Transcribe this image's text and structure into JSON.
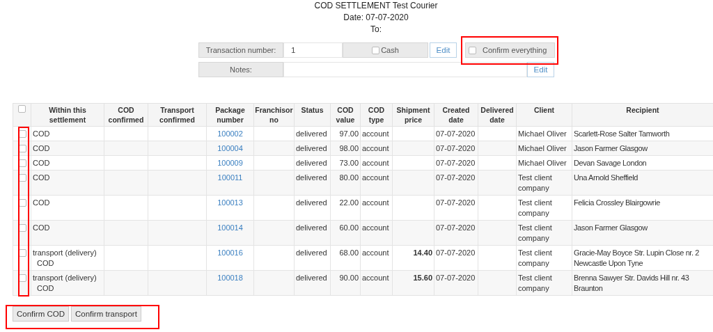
{
  "header": {
    "title": "COD SETTLEMENT Test Courier",
    "date": "Date: 07-07-2020",
    "to": "To:"
  },
  "form": {
    "transaction_label": "Transaction number:",
    "transaction_value": "1",
    "cash": {
      "label": "Cash",
      "checked": false
    },
    "edit_button": "Edit",
    "confirm_everything": {
      "label": "Confirm everything",
      "checked": false
    },
    "notes_label": "Notes:",
    "notes_edit_button": "Edit"
  },
  "table": {
    "select_all": {
      "checked": false
    },
    "columns": [
      "Within this settlement",
      "COD confirmed",
      "Transport confirmed",
      "Package number",
      "Franchisor no",
      "Status",
      "COD value",
      "COD type",
      "Shipment price",
      "Created date",
      "Delivered date",
      "Client",
      "Recipient"
    ],
    "rows": [
      {
        "checked": false,
        "within": [
          "COD"
        ],
        "cod_confirmed": "",
        "transport_confirmed": "",
        "package": "100002",
        "franchisor": "",
        "status": "delivered",
        "cod_value": "97.00",
        "cod_type": "account",
        "shipment_price": "",
        "created": "07-07-2020",
        "delivered": "",
        "client": "Michael Oliver",
        "recipient": "Scarlett-Rose Salter Tamworth"
      },
      {
        "checked": false,
        "within": [
          "COD"
        ],
        "package": "100004",
        "status": "delivered",
        "cod_value": "98.00",
        "cod_type": "account",
        "created": "07-07-2020",
        "client": "Michael Oliver",
        "recipient": "Jason Farmer Glasgow"
      },
      {
        "checked": false,
        "within": [
          "COD"
        ],
        "package": "100009",
        "status": "delivered",
        "cod_value": "73.00",
        "cod_type": "account",
        "created": "07-07-2020",
        "client": "Michael Oliver",
        "recipient": "Devan Savage London"
      },
      {
        "checked": false,
        "within": [
          "COD"
        ],
        "package": "100011",
        "status": "delivered",
        "cod_value": "80.00",
        "cod_type": "account",
        "created": "07-07-2020",
        "client": "Test client company",
        "recipient": "Una Arnold Sheffield"
      },
      {
        "checked": false,
        "within": [
          "COD"
        ],
        "package": "100013",
        "status": "delivered",
        "cod_value": "22.00",
        "cod_type": "account",
        "created": "07-07-2020",
        "client": "Test client company",
        "recipient": "Felicia Crossley Blairgowrie"
      },
      {
        "checked": false,
        "within": [
          "COD"
        ],
        "package": "100014",
        "status": "delivered",
        "cod_value": "60.00",
        "cod_type": "account",
        "created": "07-07-2020",
        "client": "Test client company",
        "recipient": "Jason Farmer Glasgow"
      },
      {
        "checked": false,
        "within": [
          "transport (delivery)",
          "COD"
        ],
        "package": "100016",
        "status": "delivered",
        "cod_value": "68.00",
        "cod_type": "account",
        "shipment_price": "14.40",
        "created": "07-07-2020",
        "client": "Test client company",
        "recipient": "Gracie-May Boyce Str. Lupin Close nr. 2 Newcastle Upon Tyne"
      },
      {
        "checked": false,
        "within": [
          "transport (delivery)",
          "COD"
        ],
        "package": "100018",
        "status": "delivered",
        "cod_value": "90.00",
        "cod_type": "account",
        "shipment_price": "15.60",
        "created": "07-07-2020",
        "client": "Test client company",
        "recipient": "Brenna Sawyer Str. Davids Hill nr. 43 Braunton"
      }
    ]
  },
  "buttons": [
    "Confirm COD",
    "Confirm transport"
  ]
}
